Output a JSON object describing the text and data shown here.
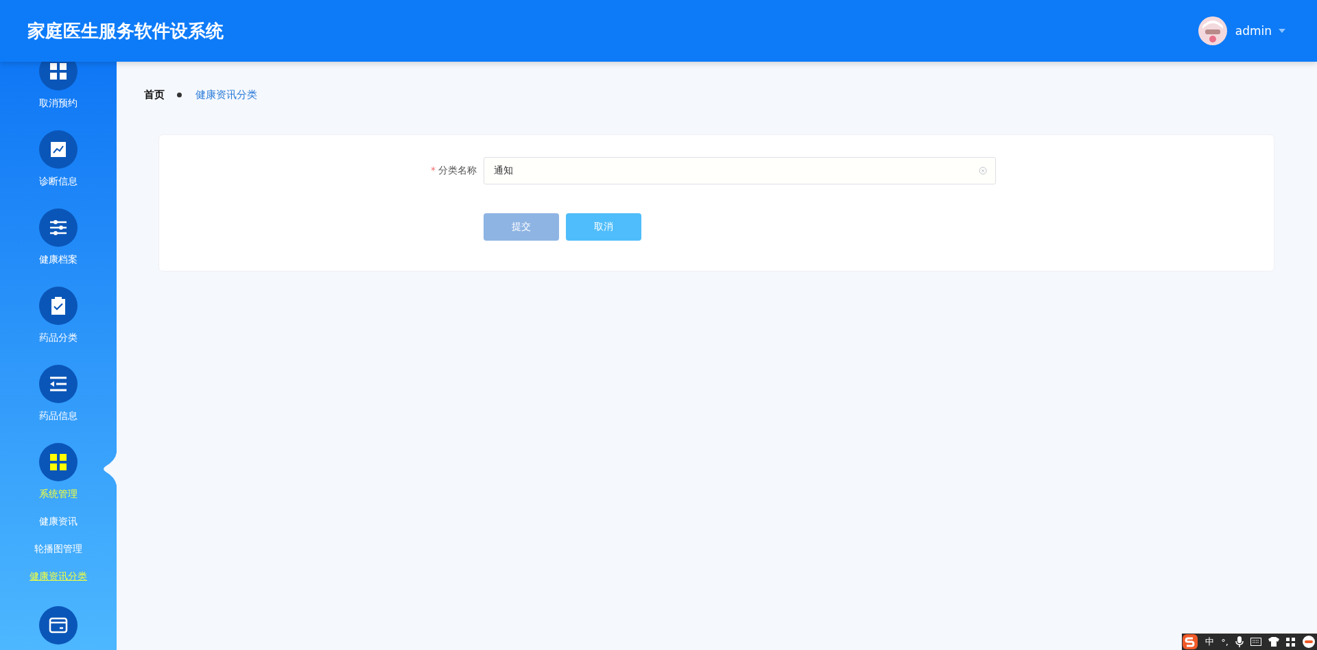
{
  "header": {
    "title": "家庭医生服务软件设系统",
    "user": "admin"
  },
  "sidebar": {
    "items": [
      {
        "label": "取消预约",
        "selected": false
      },
      {
        "label": "诊断信息",
        "selected": false
      },
      {
        "label": "健康档案",
        "selected": false
      },
      {
        "label": "药品分类",
        "selected": false
      },
      {
        "label": "药品信息",
        "selected": false
      },
      {
        "label": "系统管理",
        "selected": true,
        "children": [
          {
            "label": "健康资讯",
            "selected": false
          },
          {
            "label": "轮播图管理",
            "selected": false
          },
          {
            "label": "健康资讯分类",
            "selected": true
          }
        ]
      },
      {
        "selected": false
      }
    ]
  },
  "breadcrumb": [
    "首页",
    "健康资讯分类"
  ],
  "form": {
    "field": {
      "label": "分类名称",
      "required_mark": "*",
      "value": "通知"
    },
    "buttons": [
      {
        "label": "提交",
        "kind": "submit"
      },
      {
        "label": "取消",
        "kind": "cancel"
      }
    ]
  },
  "ime_toolbar": {
    "labels": [
      "中",
      "°,"
    ]
  }
}
